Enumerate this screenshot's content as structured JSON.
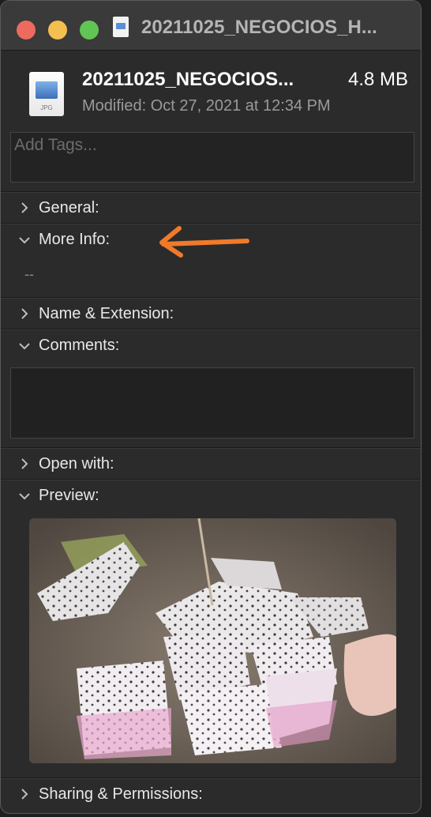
{
  "window": {
    "title": "20211025_NEGOCIOS_H..."
  },
  "file": {
    "name": "20211025_NEGOCIOS...",
    "size": "4.8 MB",
    "modified": "Modified: Oct 27, 2021 at 12:34 PM",
    "icon_ext": "JPG"
  },
  "tags": {
    "placeholder": "Add Tags..."
  },
  "sections": {
    "general": "General:",
    "more_info": "More Info:",
    "more_info_value": "--",
    "name_extension": "Name & Extension:",
    "comments": "Comments:",
    "open_with": "Open with:",
    "preview": "Preview:",
    "sharing": "Sharing & Permissions:"
  },
  "annotation": {
    "arrow_color": "#f07a2a"
  },
  "colors": {
    "close": "#ed6a5e",
    "minimize": "#f5bf4f",
    "maximize": "#61c554"
  }
}
